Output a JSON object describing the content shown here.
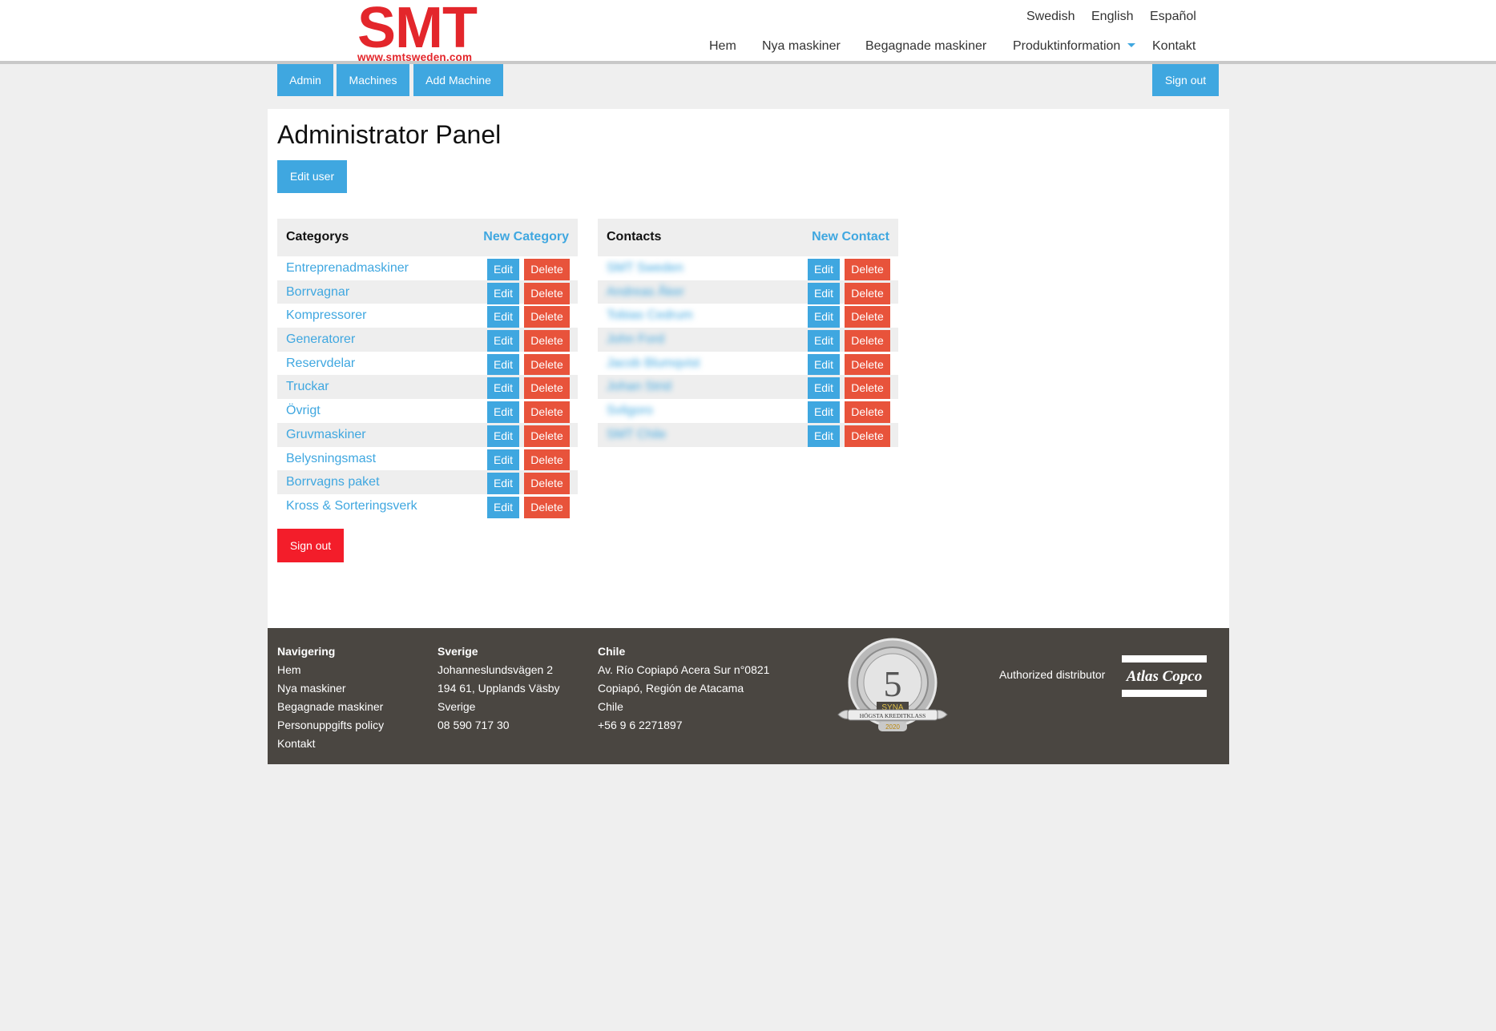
{
  "header": {
    "logo_text": "SMT",
    "logo_url": "www.smtsweden.com",
    "languages": [
      "Swedish",
      "English",
      "Español"
    ],
    "nav": [
      "Hem",
      "Nya maskiner",
      "Begagnade maskiner",
      "Produktinformation",
      "Kontakt"
    ]
  },
  "admin_bar": {
    "admin": "Admin",
    "machines": "Machines",
    "add_machine": "Add Machine",
    "sign_out": "Sign out"
  },
  "main": {
    "title": "Administrator Panel",
    "edit_user": "Edit user",
    "sign_out": "Sign out"
  },
  "categories": {
    "header": "Categorys",
    "new_label": "New Category",
    "edit_label": "Edit",
    "delete_label": "Delete",
    "items": [
      "Entreprenadmaskiner",
      "Borrvagnar",
      "Kompressorer",
      "Generatorer",
      "Reservdelar",
      "Truckar",
      "Övrigt",
      "Gruvmaskiner",
      "Belysningsmast",
      "Borrvagns paket",
      "Kross & Sorteringsverk"
    ]
  },
  "contacts": {
    "header": "Contacts",
    "new_label": "New Contact",
    "edit_label": "Edit",
    "delete_label": "Delete",
    "items": [
      "SMT Sweden",
      "Andreas Åker",
      "Tobias Cedrum",
      "John Ford",
      "Jacob Blumqvist",
      "Johan Strid",
      "Svligoro",
      "SMT Chile"
    ]
  },
  "footer": {
    "nav": {
      "heading": "Navigering",
      "links": [
        "Hem",
        "Nya maskiner",
        "Begagnade maskiner",
        "Personuppgifts policy",
        "Kontakt"
      ]
    },
    "sverige": {
      "heading": "Sverige",
      "lines": [
        "Johanneslundsvägen 2",
        "194 61, Upplands Väsby",
        "Sverige",
        "08 590 717 30"
      ]
    },
    "chile": {
      "heading": "Chile",
      "lines": [
        "Av. Río Copiapó Acera Sur n°0821",
        "Copiapó, Región de Atacama",
        "Chile",
        "+56 9 6 2271897"
      ]
    },
    "authorized": "Authorized distributor",
    "atlas_logo": "Atlas Copco",
    "seal": {
      "number": "5",
      "band": "SYNA",
      "ribbon": "HÖGSTA KREDITKLASS",
      "year": "2020"
    }
  },
  "colors": {
    "accent": "#3fa7e0",
    "delete": "#e8533b",
    "signout": "#f31d2a",
    "logo": "#e3262b",
    "footer": "#4a4641"
  }
}
